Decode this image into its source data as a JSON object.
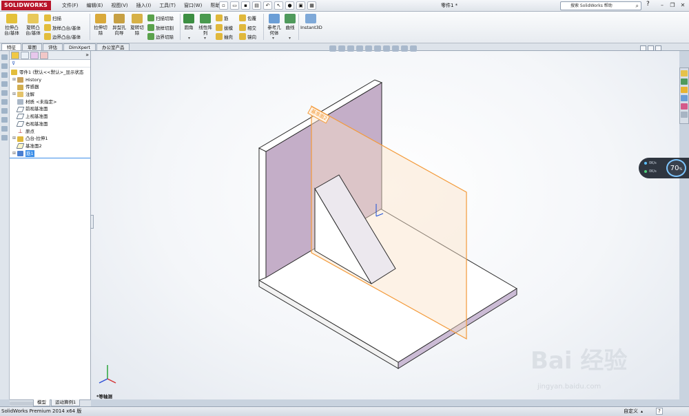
{
  "app": {
    "logo": "SOLIDWORKS",
    "doc_title": "零件1 *",
    "search_placeholder": "搜索 SolidWorks 帮助"
  },
  "menu": [
    "文件(F)",
    "编辑(E)",
    "视图(V)",
    "插入(I)",
    "工具(T)",
    "窗口(W)",
    "帮助(H)"
  ],
  "commands": {
    "extrude_boss": "拉伸凸\n台/基体",
    "revolve_boss": "旋转凸\n台/基体",
    "sweep": "扫描",
    "loft_boss": "放样凸台/基体",
    "boundary_boss": "边界凸台/基体",
    "extrude_cut": "拉伸切\n除",
    "hole_wizard": "异型孔\n向导",
    "revolve_cut": "旋转切\n除",
    "swept_cut": "扫描切除",
    "lofted_cut": "放样切割",
    "boundary_cut": "边界切除",
    "fillet": "圆角",
    "linear_pattern": "线性阵\n列",
    "rib": "筋",
    "draft": "拔模",
    "shell": "抽壳",
    "wrap": "包覆",
    "intersect": "相交",
    "mirror": "镜向",
    "ref_geometry": "参考几\n何体",
    "curves": "曲线",
    "instant3d": "Instant3D"
  },
  "tabs": [
    "特征",
    "草图",
    "评估",
    "DimXpert",
    "办公室产品"
  ],
  "tree": {
    "root": "零件1 (默认<<默认>_显示状态",
    "items": [
      {
        "label": "History",
        "expandable": true
      },
      {
        "label": "传感器",
        "expandable": false
      },
      {
        "label": "注解",
        "expandable": true
      },
      {
        "label": "材质 <未指定>",
        "expandable": false
      },
      {
        "label": "前视基准面",
        "expandable": false
      },
      {
        "label": "上视基准面",
        "expandable": false
      },
      {
        "label": "右视基准面",
        "expandable": false
      },
      {
        "label": "原点",
        "expandable": false
      },
      {
        "label": "凸台-拉伸1",
        "expandable": true
      },
      {
        "label": "基准面2",
        "expandable": false
      },
      {
        "label": "筋1",
        "expandable": true,
        "selected": true
      }
    ]
  },
  "viewport": {
    "view_label": "*等轴测",
    "plane_tag": "基准面2"
  },
  "bottom_tabs": [
    "模型",
    "运动算例1"
  ],
  "meter": {
    "up": "0K/s",
    "down": "0K/s",
    "percent": "70",
    "unit": "%"
  },
  "status": {
    "left": "SolidWorks Premium 2014 x64 版",
    "custom": "自定义",
    "help": "?"
  },
  "watermark": {
    "brand": "Bai 经验",
    "url": "jingyan.baidu.com"
  },
  "colors": {
    "wall": "#c9b1c9",
    "plane": "#f39a3a",
    "base": "#ffffff",
    "accent": "#b8142a"
  }
}
